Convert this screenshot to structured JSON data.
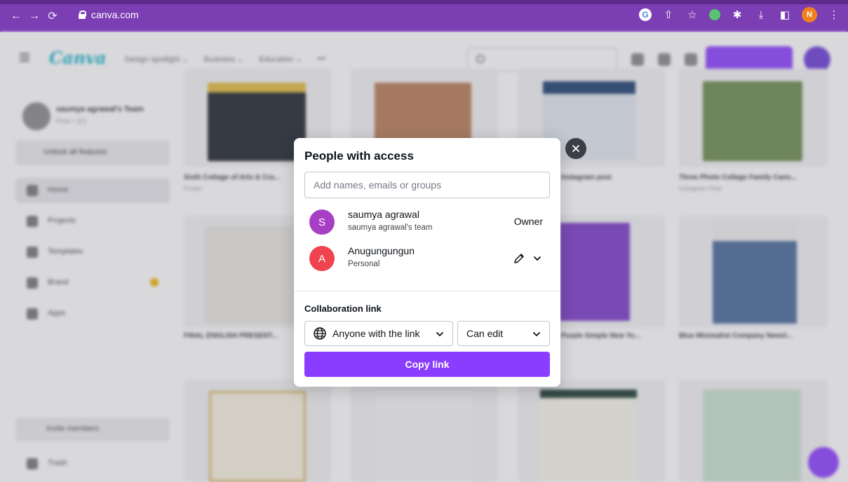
{
  "browser": {
    "url": "canva.com",
    "profile_initial": "N",
    "back_icon": "back-arrow-icon",
    "forward_icon": "forward-arrow-icon",
    "reload_icon": "reload-icon"
  },
  "modal": {
    "title": "People with access",
    "add_placeholder": "Add names, emails or groups",
    "people": [
      {
        "initial": "S",
        "name": "saumya agrawal",
        "subtitle": "saumya agrawal's team",
        "role": "Owner",
        "avatar_color": "#a73fc4"
      },
      {
        "initial": "A",
        "name": "Anugungungun",
        "subtitle": "Personal",
        "role_icon": "pencil-icon",
        "avatar_color": "#f0424f"
      }
    ],
    "collab_label": "Collaboration link",
    "link_access": "Anyone with the link",
    "permission": "Can edit",
    "copy_button": "Copy link",
    "close_icon": "close-icon"
  },
  "colors": {
    "brand_purple": "#8b3dff",
    "browser_purple": "#7c3fb3",
    "close_dark": "#3c3f45"
  }
}
